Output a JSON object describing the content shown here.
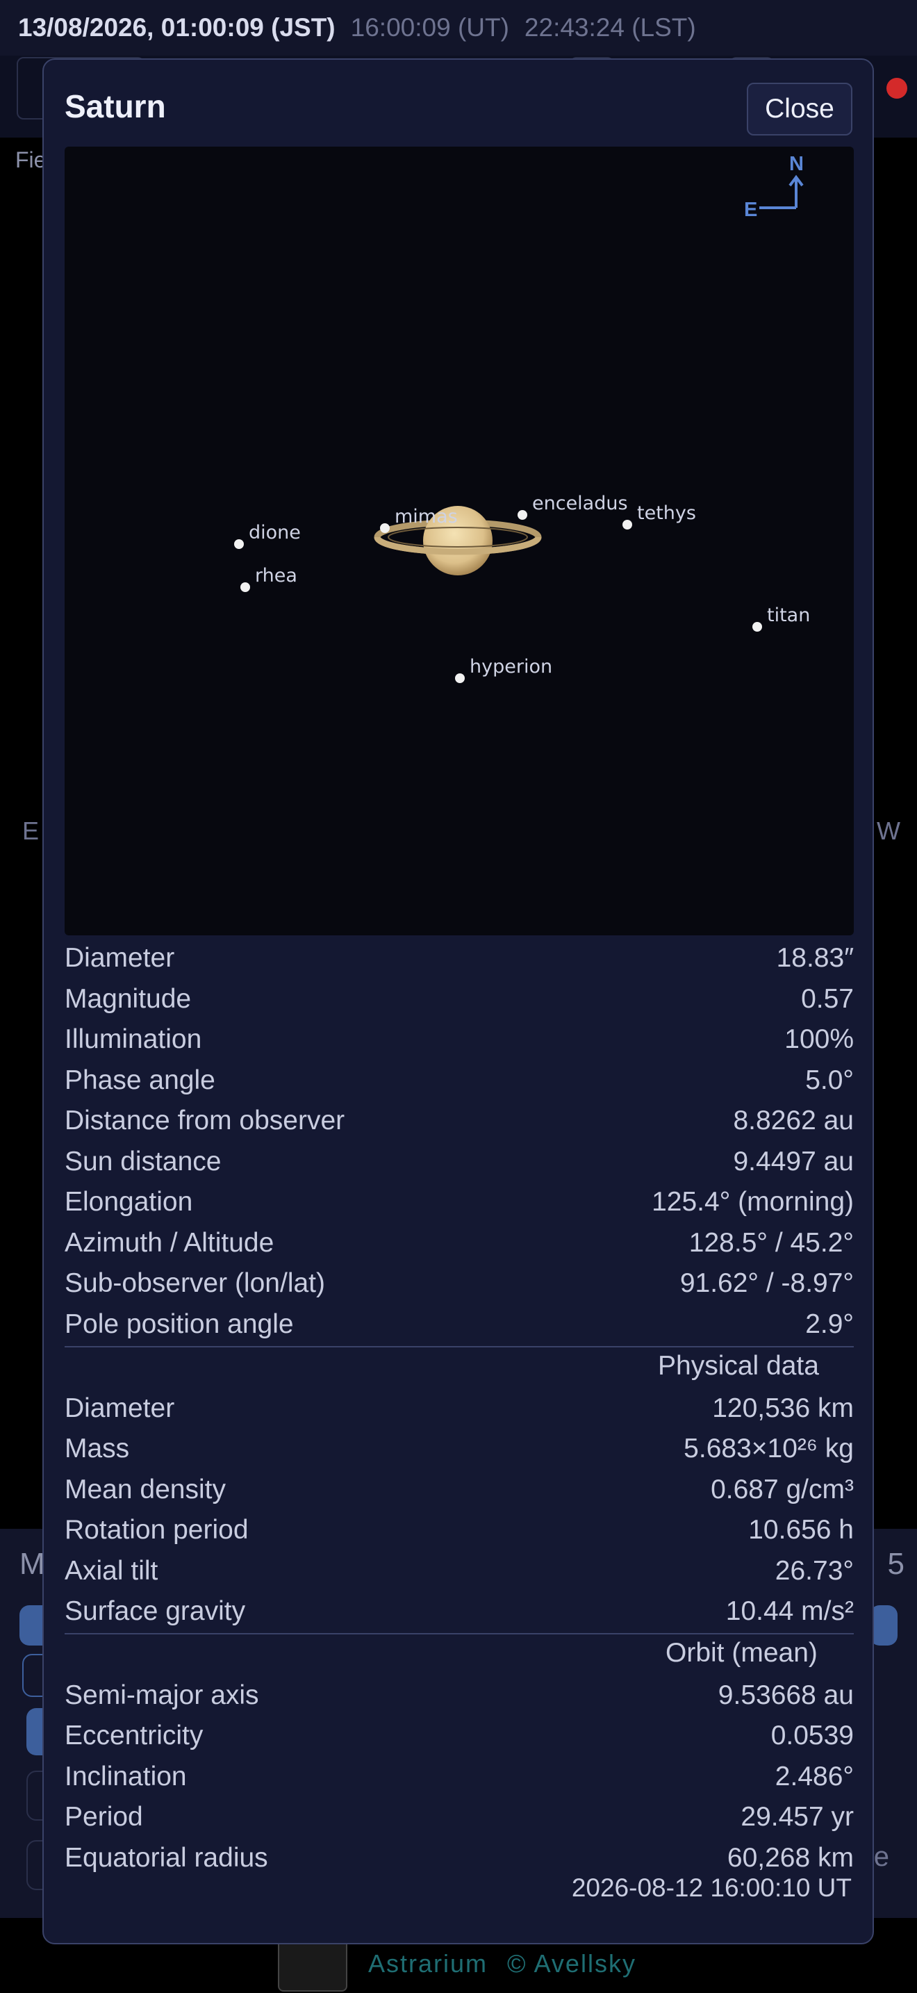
{
  "topbar": {
    "jst": "13/08/2026, 01:00:09 (JST)",
    "ut": "16:00:09 (UT)",
    "lst": "22:43:24 (LST)"
  },
  "background": {
    "field_label": "Fie",
    "sky_east": "E",
    "sky_west": "W",
    "panel_left": "M",
    "panel_right": "5",
    "panel_edge": "e",
    "brand": "Astrarium",
    "copyright": "© Avellsky"
  },
  "dialog": {
    "title": "Saturn",
    "close_label": "Close",
    "compass": {
      "north": "N",
      "east": "E"
    },
    "moons": {
      "mimas": "mimas",
      "enceladus": "enceladus",
      "tethys": "tethys",
      "dione": "dione",
      "rhea": "rhea",
      "titan": "titan",
      "hyperion": "hyperion"
    },
    "ephemeris": [
      {
        "label": "Diameter",
        "value": "18.83″"
      },
      {
        "label": "Magnitude",
        "value": "0.57"
      },
      {
        "label": "Illumination",
        "value": "100%"
      },
      {
        "label": "Phase angle",
        "value": "5.0°"
      },
      {
        "label": "Distance from observer",
        "value": "8.8262 au"
      },
      {
        "label": "Sun distance",
        "value": "9.4497 au"
      },
      {
        "label": "Elongation",
        "value": "125.4° (morning)"
      },
      {
        "label": "Azimuth / Altitude",
        "value": "128.5° / 45.2°"
      },
      {
        "label": "Sub-observer (lon/lat)",
        "value": "91.62° / -8.97°"
      },
      {
        "label": "Pole position angle",
        "value": "2.9°"
      }
    ],
    "physical_title": "Physical data",
    "physical": [
      {
        "label": "Diameter",
        "value": "120,536 km"
      },
      {
        "label": "Mass",
        "value": "5.683×10²⁶ kg"
      },
      {
        "label": "Mean density",
        "value": "0.687 g/cm³"
      },
      {
        "label": "Rotation period",
        "value": "10.656 h"
      },
      {
        "label": "Axial tilt",
        "value": "26.73°"
      },
      {
        "label": "Surface gravity",
        "value": "10.44 m/s²"
      }
    ],
    "orbit_title": "Orbit (mean)",
    "orbit": [
      {
        "label": "Semi-major axis",
        "value": "9.53668 au"
      },
      {
        "label": "Eccentricity",
        "value": "0.0539"
      },
      {
        "label": "Inclination",
        "value": "2.486°"
      },
      {
        "label": "Period",
        "value": "29.457 yr"
      },
      {
        "label": "Equatorial radius",
        "value": "60,268 km"
      }
    ],
    "timestamp": "2026-08-12 16:00:10 UT"
  }
}
